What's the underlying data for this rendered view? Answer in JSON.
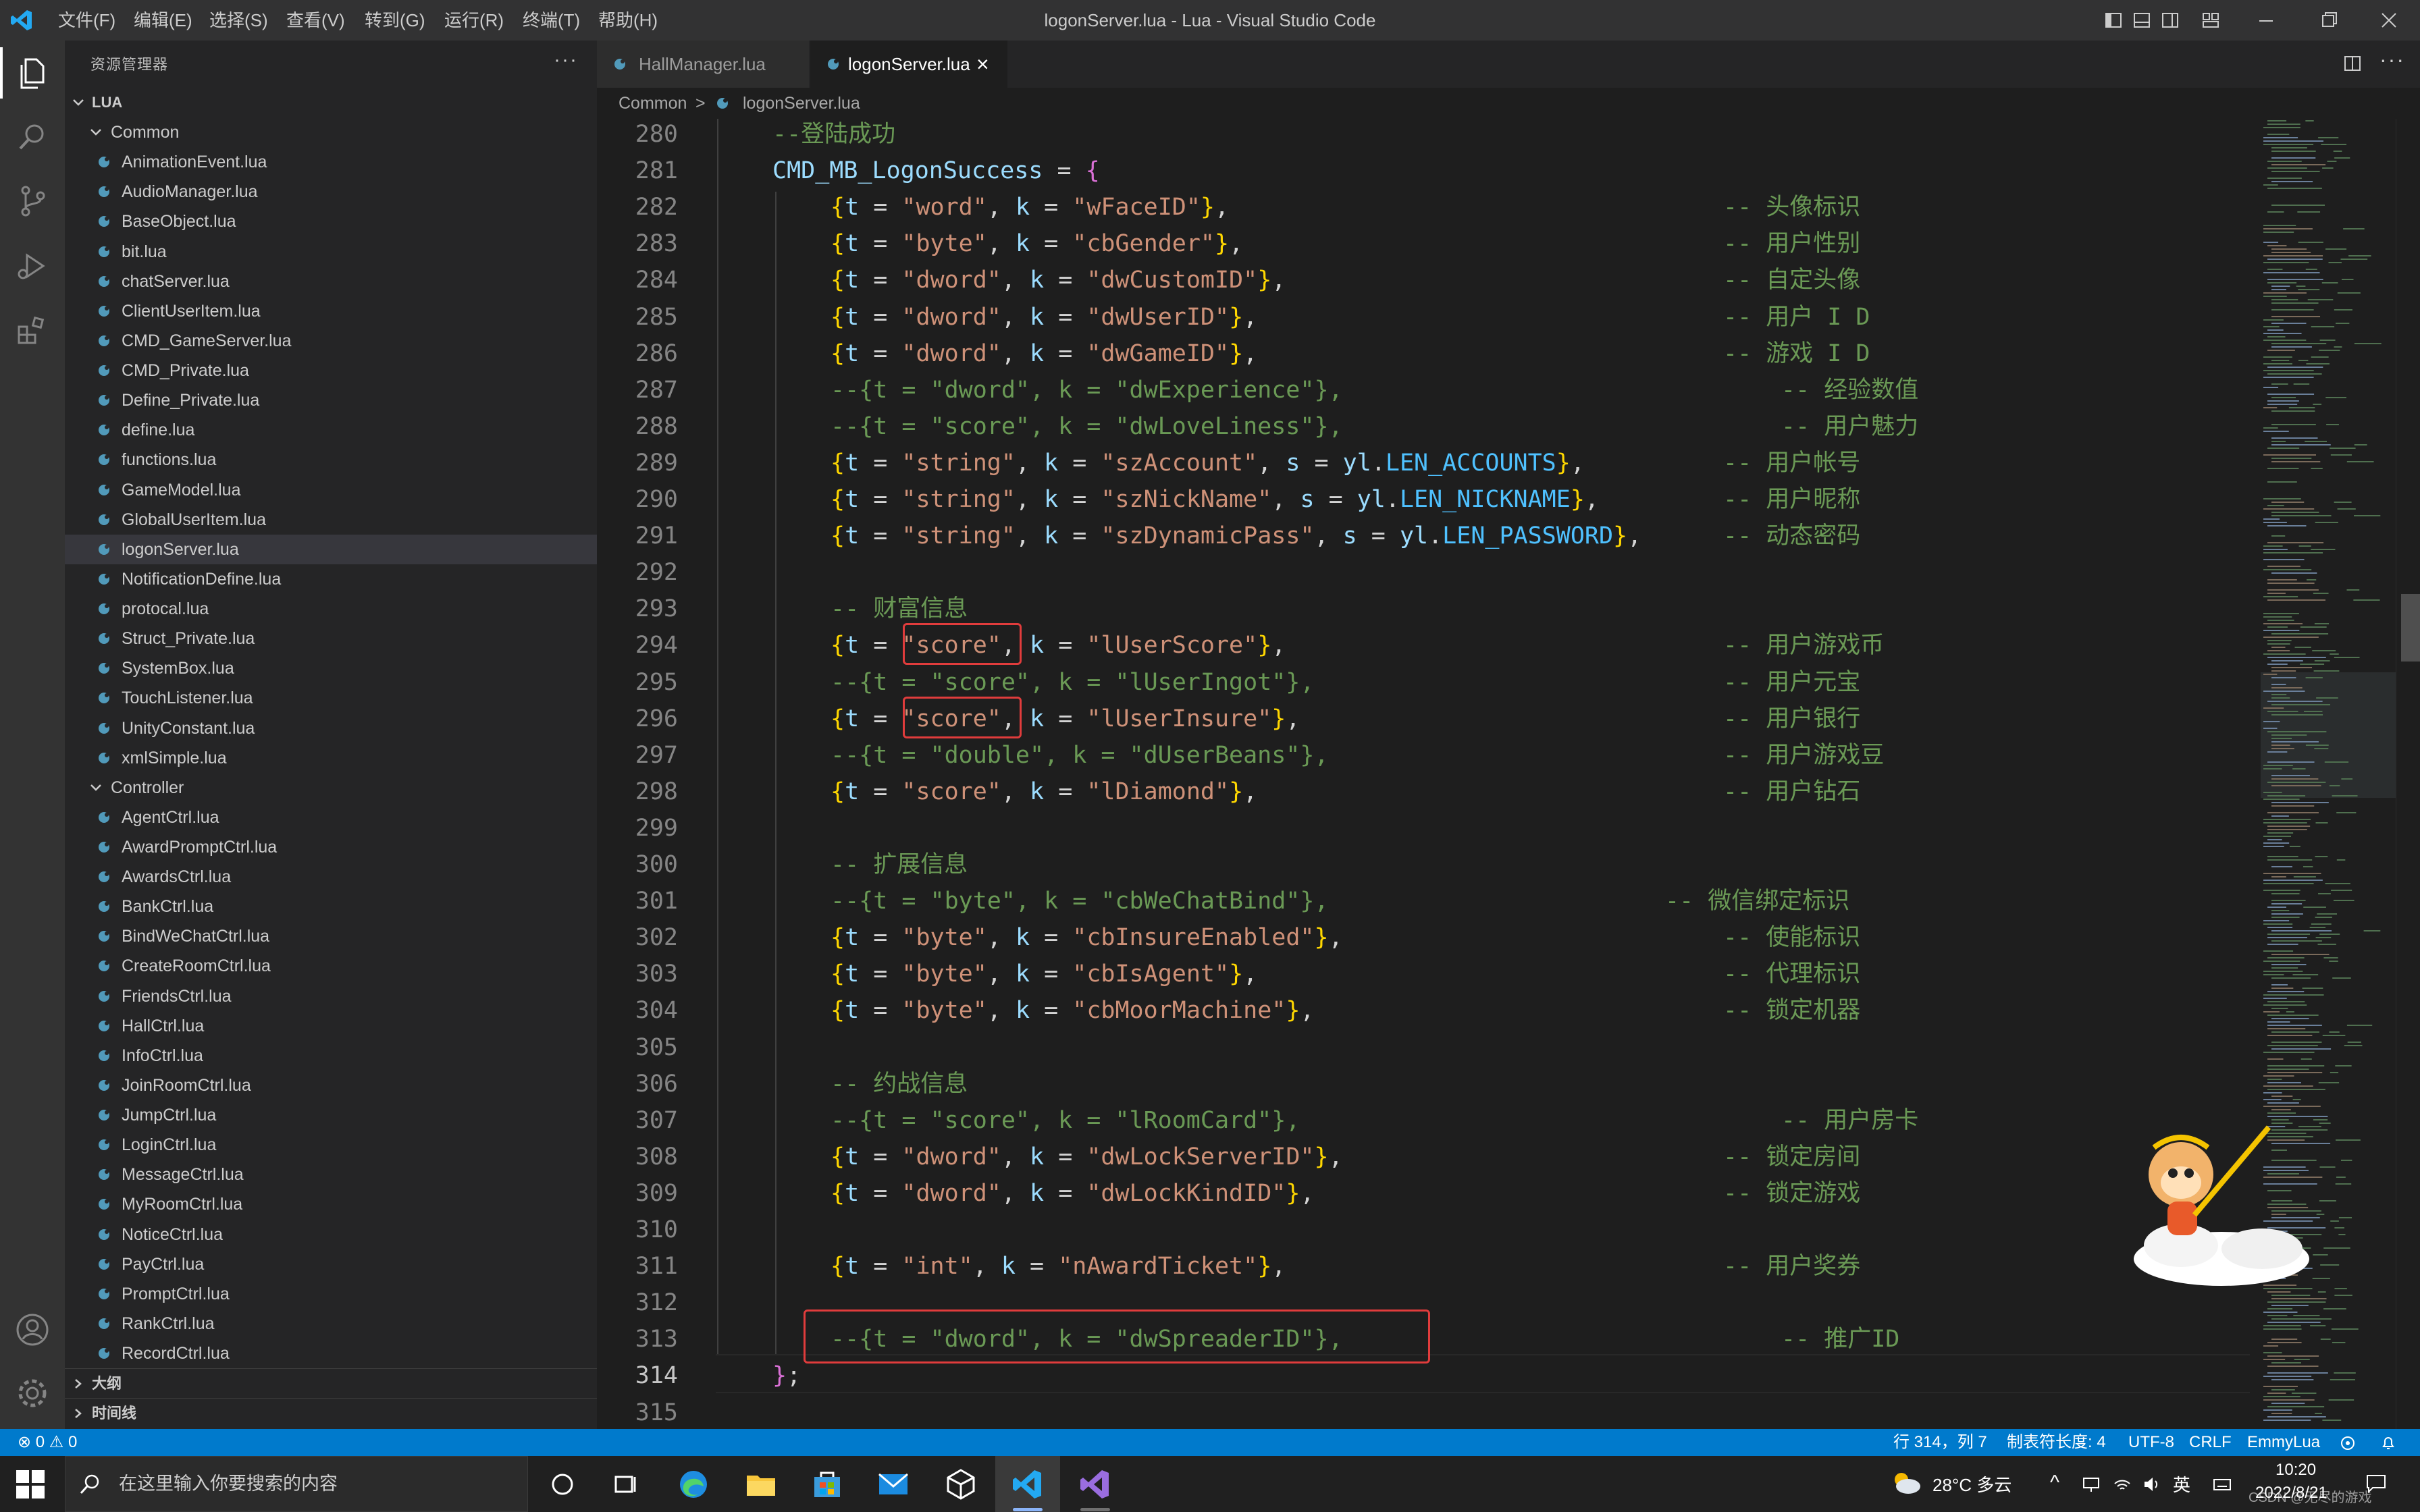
{
  "window": {
    "title": "logonServer.lua - Lua - Visual Studio Code",
    "menu": [
      "文件(F)",
      "编辑(E)",
      "选择(S)",
      "查看(V)",
      "转到(G)",
      "运行(R)",
      "终端(T)",
      "帮助(H)"
    ]
  },
  "activity_bar": {
    "icons": [
      "files-icon",
      "search-icon",
      "source-control-icon",
      "run-debug-icon",
      "extensions-icon",
      "account-icon",
      "settings-gear-icon"
    ]
  },
  "sidebar": {
    "title": "资源管理器",
    "more": "···",
    "root": "LUA",
    "folders": [
      {
        "name": "Common",
        "files": [
          "AnimationEvent.lua",
          "AudioManager.lua",
          "BaseObject.lua",
          "bit.lua",
          "chatServer.lua",
          "ClientUserItem.lua",
          "CMD_GameServer.lua",
          "CMD_Private.lua",
          "Define_Private.lua",
          "define.lua",
          "functions.lua",
          "GameModel.lua",
          "GlobalUserItem.lua",
          "logonServer.lua",
          "NotificationDefine.lua",
          "protocal.lua",
          "Struct_Private.lua",
          "SystemBox.lua",
          "TouchListener.lua",
          "UnityConstant.lua",
          "xmlSimple.lua"
        ]
      },
      {
        "name": "Controller",
        "files": [
          "AgentCtrl.lua",
          "AwardPromptCtrl.lua",
          "AwardsCtrl.lua",
          "BankCtrl.lua",
          "BindWeChatCtrl.lua",
          "CreateRoomCtrl.lua",
          "FriendsCtrl.lua",
          "HallCtrl.lua",
          "InfoCtrl.lua",
          "JoinRoomCtrl.lua",
          "JumpCtrl.lua",
          "LoginCtrl.lua",
          "MessageCtrl.lua",
          "MyRoomCtrl.lua",
          "NoticeCtrl.lua",
          "PayCtrl.lua",
          "PromptCtrl.lua",
          "RankCtrl.lua",
          "RecordCtrl.lua"
        ]
      }
    ],
    "selected_file": "logonServer.lua",
    "outline_label": "大纲",
    "timeline_label": "时间线"
  },
  "tabs": [
    {
      "label": "HallManager.lua",
      "active": false
    },
    {
      "label": "logonServer.lua",
      "active": true,
      "close": "×"
    }
  ],
  "breadcrumb": {
    "folder": "Common",
    "sep": ">",
    "file": "logonServer.lua"
  },
  "editor": {
    "lines": [
      {
        "n": "280",
        "segs": [
          [
            "cm",
            "--登陆成功"
          ]
        ]
      },
      {
        "n": "281",
        "segs": [
          [
            "var",
            "CMD_MB_LogonSuccess"
          ],
          [
            "op",
            " = "
          ],
          [
            "brace",
            "{"
          ]
        ]
      },
      {
        "n": "282",
        "segs": [
          [
            "gb",
            "{"
          ],
          [
            "var",
            "t"
          ],
          [
            "op",
            " = "
          ],
          [
            "str",
            "\"word\""
          ],
          [
            "op",
            ", "
          ],
          [
            "var",
            "k"
          ],
          [
            "op",
            " = "
          ],
          [
            "str",
            "\"wFaceID\""
          ],
          [
            "gb",
            "}"
          ],
          [
            "op",
            ","
          ]
        ],
        "comment": "-- 头像标识",
        "ccol": 1
      },
      {
        "n": "283",
        "segs": [
          [
            "gb",
            "{"
          ],
          [
            "var",
            "t"
          ],
          [
            "op",
            " = "
          ],
          [
            "str",
            "\"byte\""
          ],
          [
            "op",
            ", "
          ],
          [
            "var",
            "k"
          ],
          [
            "op",
            " = "
          ],
          [
            "str",
            "\"cbGender\""
          ],
          [
            "gb",
            "}"
          ],
          [
            "op",
            ","
          ]
        ],
        "comment": "-- 用户性别",
        "ccol": 1
      },
      {
        "n": "284",
        "segs": [
          [
            "gb",
            "{"
          ],
          [
            "var",
            "t"
          ],
          [
            "op",
            " = "
          ],
          [
            "str",
            "\"dword\""
          ],
          [
            "op",
            ", "
          ],
          [
            "var",
            "k"
          ],
          [
            "op",
            " = "
          ],
          [
            "str",
            "\"dwCustomID\""
          ],
          [
            "gb",
            "}"
          ],
          [
            "op",
            ","
          ]
        ],
        "comment": "-- 自定头像",
        "ccol": 1
      },
      {
        "n": "285",
        "segs": [
          [
            "gb",
            "{"
          ],
          [
            "var",
            "t"
          ],
          [
            "op",
            " = "
          ],
          [
            "str",
            "\"dword\""
          ],
          [
            "op",
            ", "
          ],
          [
            "var",
            "k"
          ],
          [
            "op",
            " = "
          ],
          [
            "str",
            "\"dwUserID\""
          ],
          [
            "gb",
            "}"
          ],
          [
            "op",
            ","
          ]
        ],
        "comment": "-- 用户 I D",
        "ccol": 1
      },
      {
        "n": "286",
        "segs": [
          [
            "gb",
            "{"
          ],
          [
            "var",
            "t"
          ],
          [
            "op",
            " = "
          ],
          [
            "str",
            "\"dword\""
          ],
          [
            "op",
            ", "
          ],
          [
            "var",
            "k"
          ],
          [
            "op",
            " = "
          ],
          [
            "str",
            "\"dwGameID\""
          ],
          [
            "gb",
            "}"
          ],
          [
            "op",
            ","
          ]
        ],
        "comment": "-- 游戏 I D",
        "ccol": 1
      },
      {
        "n": "287",
        "segs": [
          [
            "cm",
            "--{t = \"dword\", k = \"dwExperience\"},"
          ]
        ],
        "comment": "-- 经验数值",
        "ccol": 2
      },
      {
        "n": "288",
        "segs": [
          [
            "cm",
            "--{t = \"score\", k = \"dwLoveLiness\"},"
          ]
        ],
        "comment": "-- 用户魅力",
        "ccol": 2
      },
      {
        "n": "289",
        "segs": [
          [
            "gb",
            "{"
          ],
          [
            "var",
            "t"
          ],
          [
            "op",
            " = "
          ],
          [
            "str",
            "\"string\""
          ],
          [
            "op",
            ", "
          ],
          [
            "var",
            "k"
          ],
          [
            "op",
            " = "
          ],
          [
            "str",
            "\"szAccount\""
          ],
          [
            "op",
            ", "
          ],
          [
            "var",
            "s"
          ],
          [
            "op",
            " = "
          ],
          [
            "var",
            "yl"
          ],
          [
            "op",
            "."
          ],
          [
            "const",
            "LEN_ACCOUNTS"
          ],
          [
            "gb",
            "}"
          ],
          [
            "op",
            ","
          ]
        ],
        "comment": "-- 用户帐号",
        "ccol": 1
      },
      {
        "n": "290",
        "segs": [
          [
            "gb",
            "{"
          ],
          [
            "var",
            "t"
          ],
          [
            "op",
            " = "
          ],
          [
            "str",
            "\"string\""
          ],
          [
            "op",
            ", "
          ],
          [
            "var",
            "k"
          ],
          [
            "op",
            " = "
          ],
          [
            "str",
            "\"szNickName\""
          ],
          [
            "op",
            ", "
          ],
          [
            "var",
            "s"
          ],
          [
            "op",
            " = "
          ],
          [
            "var",
            "yl"
          ],
          [
            "op",
            "."
          ],
          [
            "const",
            "LEN_NICKNAME"
          ],
          [
            "gb",
            "}"
          ],
          [
            "op",
            ","
          ]
        ],
        "comment": "-- 用户昵称",
        "ccol": 1
      },
      {
        "n": "291",
        "segs": [
          [
            "gb",
            "{"
          ],
          [
            "var",
            "t"
          ],
          [
            "op",
            " = "
          ],
          [
            "str",
            "\"string\""
          ],
          [
            "op",
            ", "
          ],
          [
            "var",
            "k"
          ],
          [
            "op",
            " = "
          ],
          [
            "str",
            "\"szDynamicPass\""
          ],
          [
            "op",
            ", "
          ],
          [
            "var",
            "s"
          ],
          [
            "op",
            " = "
          ],
          [
            "var",
            "yl"
          ],
          [
            "op",
            "."
          ],
          [
            "const",
            "LEN_PASSWORD"
          ],
          [
            "gb",
            "}"
          ],
          [
            "op",
            ","
          ]
        ],
        "comment": "-- 动态密码",
        "ccol": 1
      },
      {
        "n": "292",
        "segs": []
      },
      {
        "n": "293",
        "segs": [
          [
            "cm",
            "-- 财富信息"
          ]
        ]
      },
      {
        "n": "294",
        "segs": [
          [
            "gb",
            "{"
          ],
          [
            "var",
            "t"
          ],
          [
            "op",
            " = "
          ],
          [
            "str",
            "\"score\""
          ],
          [
            "op",
            ", "
          ],
          [
            "var",
            "k"
          ],
          [
            "op",
            " = "
          ],
          [
            "str",
            "\"lUserScore\""
          ],
          [
            "gb",
            "}"
          ],
          [
            "op",
            ","
          ]
        ],
        "comment": "-- 用户游戏币",
        "ccol": 1
      },
      {
        "n": "295",
        "segs": [
          [
            "cm",
            "--{t = \"score\", k = \"lUserIngot\"},"
          ]
        ],
        "comment": "-- 用户元宝",
        "ccol": 1
      },
      {
        "n": "296",
        "segs": [
          [
            "gb",
            "{"
          ],
          [
            "var",
            "t"
          ],
          [
            "op",
            " = "
          ],
          [
            "str",
            "\"score\""
          ],
          [
            "op",
            ", "
          ],
          [
            "var",
            "k"
          ],
          [
            "op",
            " = "
          ],
          [
            "str",
            "\"lUserInsure\""
          ],
          [
            "gb",
            "}"
          ],
          [
            "op",
            ","
          ]
        ],
        "comment": "-- 用户银行",
        "ccol": 1
      },
      {
        "n": "297",
        "segs": [
          [
            "cm",
            "--{t = \"double\", k = \"dUserBeans\"},"
          ]
        ],
        "comment": "-- 用户游戏豆",
        "ccol": 1
      },
      {
        "n": "298",
        "segs": [
          [
            "gb",
            "{"
          ],
          [
            "var",
            "t"
          ],
          [
            "op",
            " = "
          ],
          [
            "str",
            "\"score\""
          ],
          [
            "op",
            ", "
          ],
          [
            "var",
            "k"
          ],
          [
            "op",
            " = "
          ],
          [
            "str",
            "\"lDiamond\""
          ],
          [
            "gb",
            "}"
          ],
          [
            "op",
            ","
          ]
        ],
        "comment": "-- 用户钻石",
        "ccol": 1
      },
      {
        "n": "299",
        "segs": []
      },
      {
        "n": "300",
        "segs": [
          [
            "cm",
            "-- 扩展信息"
          ]
        ]
      },
      {
        "n": "301",
        "segs": [
          [
            "cm",
            "--{t = \"byte\", k = \"cbWeChatBind\"},"
          ]
        ],
        "comment": "-- 微信绑定标识",
        "ccol": 0
      },
      {
        "n": "302",
        "segs": [
          [
            "gb",
            "{"
          ],
          [
            "var",
            "t"
          ],
          [
            "op",
            " = "
          ],
          [
            "str",
            "\"byte\""
          ],
          [
            "op",
            ", "
          ],
          [
            "var",
            "k"
          ],
          [
            "op",
            " = "
          ],
          [
            "str",
            "\"cbInsureEnabled\""
          ],
          [
            "gb",
            "}"
          ],
          [
            "op",
            ","
          ]
        ],
        "comment": "-- 使能标识",
        "ccol": 1
      },
      {
        "n": "303",
        "segs": [
          [
            "gb",
            "{"
          ],
          [
            "var",
            "t"
          ],
          [
            "op",
            " = "
          ],
          [
            "str",
            "\"byte\""
          ],
          [
            "op",
            ", "
          ],
          [
            "var",
            "k"
          ],
          [
            "op",
            " = "
          ],
          [
            "str",
            "\"cbIsAgent\""
          ],
          [
            "gb",
            "}"
          ],
          [
            "op",
            ","
          ]
        ],
        "comment": "-- 代理标识",
        "ccol": 1
      },
      {
        "n": "304",
        "segs": [
          [
            "gb",
            "{"
          ],
          [
            "var",
            "t"
          ],
          [
            "op",
            " = "
          ],
          [
            "str",
            "\"byte\""
          ],
          [
            "op",
            ", "
          ],
          [
            "var",
            "k"
          ],
          [
            "op",
            " = "
          ],
          [
            "str",
            "\"cbMoorMachine\""
          ],
          [
            "gb",
            "}"
          ],
          [
            "op",
            ","
          ]
        ],
        "comment": "-- 锁定机器",
        "ccol": 1
      },
      {
        "n": "305",
        "segs": []
      },
      {
        "n": "306",
        "segs": [
          [
            "cm",
            "-- 约战信息"
          ]
        ]
      },
      {
        "n": "307",
        "segs": [
          [
            "cm",
            "--{t = \"score\", k = \"lRoomCard\"},"
          ]
        ],
        "comment": "-- 用户房卡",
        "ccol": 2
      },
      {
        "n": "308",
        "segs": [
          [
            "gb",
            "{"
          ],
          [
            "var",
            "t"
          ],
          [
            "op",
            " = "
          ],
          [
            "str",
            "\"dword\""
          ],
          [
            "op",
            ", "
          ],
          [
            "var",
            "k"
          ],
          [
            "op",
            " = "
          ],
          [
            "str",
            "\"dwLockServerID\""
          ],
          [
            "gb",
            "}"
          ],
          [
            "op",
            ","
          ]
        ],
        "comment": "-- 锁定房间",
        "ccol": 1
      },
      {
        "n": "309",
        "segs": [
          [
            "gb",
            "{"
          ],
          [
            "var",
            "t"
          ],
          [
            "op",
            " = "
          ],
          [
            "str",
            "\"dword\""
          ],
          [
            "op",
            ", "
          ],
          [
            "var",
            "k"
          ],
          [
            "op",
            " = "
          ],
          [
            "str",
            "\"dwLockKindID\""
          ],
          [
            "gb",
            "}"
          ],
          [
            "op",
            ","
          ]
        ],
        "comment": "-- 锁定游戏",
        "ccol": 1
      },
      {
        "n": "310",
        "segs": []
      },
      {
        "n": "311",
        "segs": [
          [
            "gb",
            "{"
          ],
          [
            "var",
            "t"
          ],
          [
            "op",
            " = "
          ],
          [
            "str",
            "\"int\""
          ],
          [
            "op",
            ", "
          ],
          [
            "var",
            "k"
          ],
          [
            "op",
            " = "
          ],
          [
            "str",
            "\"nAwardTicket\""
          ],
          [
            "gb",
            "}"
          ],
          [
            "op",
            ","
          ]
        ],
        "comment": "-- 用户奖券",
        "ccol": 1
      },
      {
        "n": "312",
        "segs": []
      },
      {
        "n": "313",
        "segs": [
          [
            "cm",
            "--{t = \"dword\", k = \"dwSpreaderID\"},"
          ]
        ],
        "comment": "-- 推广ID",
        "ccol": 2
      },
      {
        "n": "314",
        "segs": [
          [
            "brace",
            "}"
          ],
          [
            "op",
            ";"
          ]
        ]
      },
      {
        "n": "315",
        "segs": []
      }
    ]
  },
  "statusbar": {
    "problems": "⊗ 0 ⚠ 0",
    "position": "行 314，列 7",
    "tab_size": "制表符长度: 4",
    "encoding": "UTF-8",
    "eol": "CRLF",
    "language": "EmmyLua"
  },
  "taskbar": {
    "search_placeholder": "在这里输入你要搜索的内容",
    "weather": "28°C 多云",
    "ime": "英",
    "time": "10:20",
    "date": "2022/8/21",
    "watermark": "CSDN @无尽的游戏"
  },
  "colors": {
    "accent": "#007acc",
    "highlight_box": "#e03c3c"
  }
}
